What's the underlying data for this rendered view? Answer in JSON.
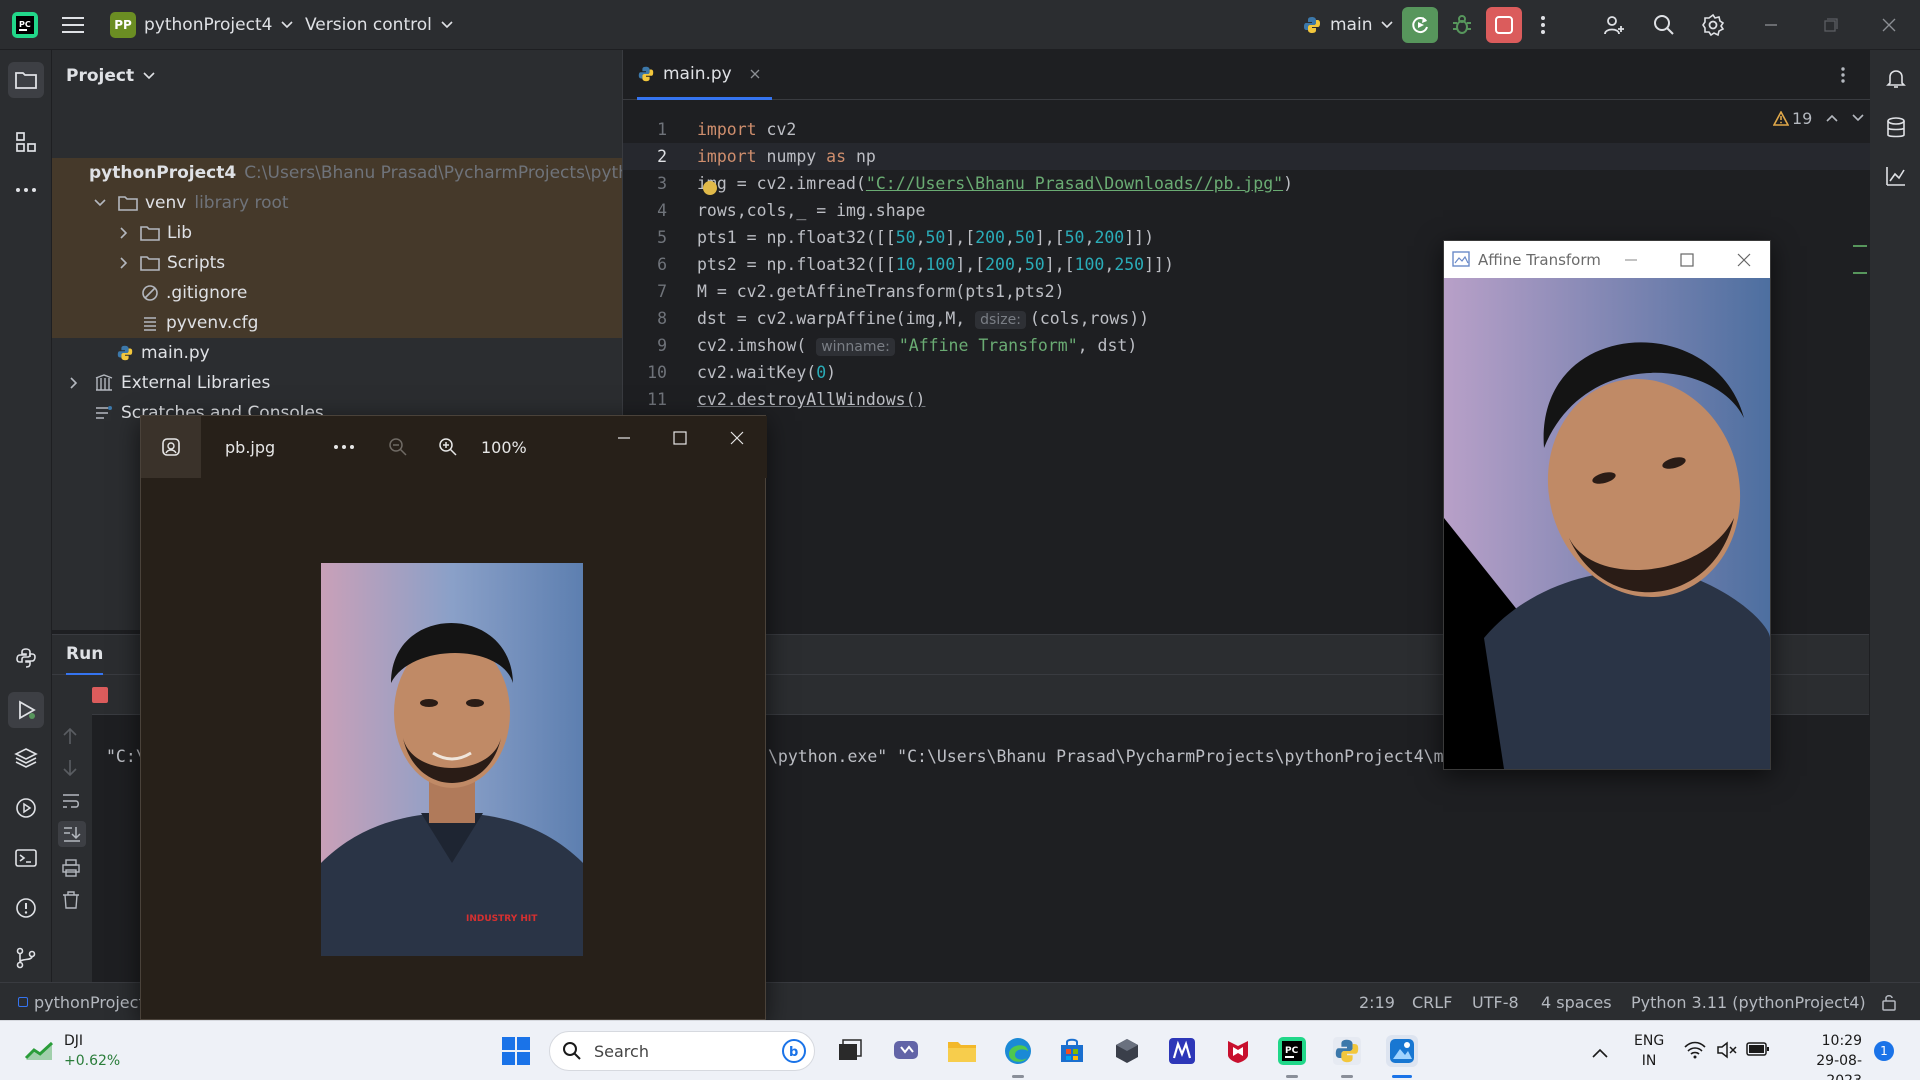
{
  "titlebar": {
    "project_badge": "PP",
    "project_name": "pythonProject4",
    "version_control": "Version control",
    "run_config": "main"
  },
  "project_panel": {
    "title": "Project",
    "tree": [
      {
        "label": "pythonProject4",
        "hint": "C:\\Users\\Bhanu Prasad\\PycharmProjects\\pythc"
      },
      {
        "label": "venv",
        "hint": "library root"
      },
      {
        "label": "Lib",
        "hint": ""
      },
      {
        "label": "Scripts",
        "hint": ""
      },
      {
        "label": ".gitignore",
        "hint": ""
      },
      {
        "label": "pyvenv.cfg",
        "hint": ""
      },
      {
        "label": "main.py",
        "hint": ""
      },
      {
        "label": "External Libraries",
        "hint": ""
      },
      {
        "label": "Scratches and Consoles",
        "hint": ""
      }
    ]
  },
  "editor": {
    "tab_label": "main.py",
    "warning_count": "19",
    "line_numbers": [
      "1",
      "2",
      "3",
      "4",
      "5",
      "6",
      "7",
      "8",
      "9",
      "10",
      "11"
    ],
    "code": {
      "l1_kw": "import",
      "l1_rest": " cv2",
      "l2_kw1": "import",
      "l2_mid": " numpy ",
      "l2_kw2": "as",
      "l2_rest": " np",
      "l3_pre": "img = cv2.imread(",
      "l3_str": "\"C://Users\\Bhanu Prasad\\Downloads//pb.jpg\"",
      "l3_post": ")",
      "l4": "rows,cols,_ = img.shape",
      "l5_pre": "pts1 = np.float32([[",
      "l5_a": "50",
      "l5_b": "50",
      "l5_c": "200",
      "l5_d": "50",
      "l5_e": "50",
      "l5_f": "200",
      "l6_pre": "pts2 = np.float32([[",
      "l6_a": "10",
      "l6_b": "100",
      "l6_c": "200",
      "l6_d": "50",
      "l6_e": "100",
      "l6_f": "250",
      "l7": "M = cv2.getAffineTransform(pts1,pts2)",
      "l8_pre": "dst = cv2.warpAffine(img,M, ",
      "l8_hint": "dsize:",
      "l8_post": "(cols,rows))",
      "l9_pre": "cv2.imshow( ",
      "l9_hint": "winname:",
      "l9_str": "\"Affine Transform\"",
      "l9_post": ", dst)",
      "l10_pre": "cv2.waitKey(",
      "l10_num": "0",
      "l10_post": ")",
      "l11": "cv2.destroyAllWindows()"
    }
  },
  "run_panel": {
    "title": "Run",
    "output_left": "\"C:\\",
    "output_right": "\\python.exe\" \"C:\\Users\\Bhanu Prasad\\PycharmProjects\\pythonProject4\\m"
  },
  "statusbar": {
    "breadcrumb": "pythonProject",
    "position": "2:19",
    "line_sep": "CRLF",
    "encoding": "UTF-8",
    "indent": "4 spaces",
    "interpreter": "Python 3.11 (pythonProject4)"
  },
  "photos": {
    "filename": "pb.jpg",
    "zoom": "100%",
    "watermark": "INDUSTRY HIT"
  },
  "affine": {
    "title": "Affine Transform"
  },
  "taskbar": {
    "stock_name": "DJI",
    "stock_change": "+0.62%",
    "search_placeholder": "Search",
    "lang_1": "ENG",
    "lang_2": "IN",
    "time": "10:29",
    "date": "29-08-2023",
    "notification_count": "1"
  },
  "colors": {
    "accent_run": "#57965c",
    "accent_stop": "#db5c5c",
    "selection_bg": "#45392a",
    "taskbar_bg": "#eef1f7"
  }
}
